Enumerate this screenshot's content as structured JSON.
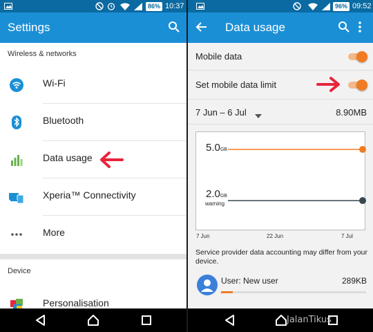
{
  "left": {
    "status": {
      "time": "10:37",
      "battery": "86%"
    },
    "app_bar": {
      "title": "Settings"
    },
    "sections": [
      {
        "header": "Wireless & networks"
      },
      {
        "header": "Device"
      }
    ],
    "items": [
      {
        "label": "Wi-Fi"
      },
      {
        "label": "Bluetooth"
      },
      {
        "label": "Data usage"
      },
      {
        "label": "Xperia™ Connectivity"
      },
      {
        "label": "More"
      },
      {
        "label": "Personalisation"
      }
    ]
  },
  "right": {
    "status": {
      "time": "09:52",
      "battery": "96%"
    },
    "app_bar": {
      "title": "Data usage"
    },
    "mobile_data": {
      "label": "Mobile data",
      "enabled": true
    },
    "data_limit": {
      "label": "Set mobile data limit",
      "enabled": true
    },
    "cycle": {
      "range": "7 Jun – 6 Jul",
      "total": "8.90MB"
    },
    "graph": {
      "limit_value": "5.0",
      "limit_unit": "GB",
      "warning_value": "2.0",
      "warning_unit": "GB",
      "warning_label": "warning",
      "x_labels": [
        "7 Jun",
        "22 Jun",
        "7 Jul"
      ]
    },
    "note": "Service provider data accounting may differ from your device.",
    "user": {
      "name": "User: New user",
      "usage": "289KB",
      "fraction": 0.08
    }
  },
  "watermark": "JalanTikus",
  "colors": {
    "status_bar": "#0a6aa1",
    "app_bar": "#1b8fd6",
    "accent": "#f07b22",
    "arrow": "#e8243c"
  }
}
